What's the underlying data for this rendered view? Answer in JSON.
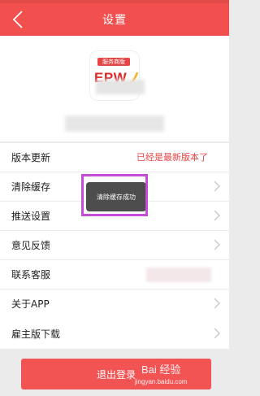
{
  "topbar": {
    "title": "设置",
    "back_icon": "back-arrow-icon"
  },
  "profile": {
    "logo_badge": "服务商版",
    "logo_text": "EPW"
  },
  "settings": {
    "items": [
      {
        "label": "版本更新",
        "value": "已经是最新版本了"
      },
      {
        "label": "清除缓存"
      },
      {
        "label": "推送设置"
      },
      {
        "label": "意见反馈"
      },
      {
        "label": "联系客服"
      },
      {
        "label": "关于APP"
      }
    ],
    "employer_download": "雇主版下载"
  },
  "logout_label": "退出登录",
  "toast": {
    "message": "清除缓存成功"
  },
  "watermark": {
    "main": "Bai 经验",
    "sub": "jingyan.baidu.com"
  },
  "colors": {
    "brand_red": "#f24f4f",
    "highlight": "#c44cd6"
  }
}
